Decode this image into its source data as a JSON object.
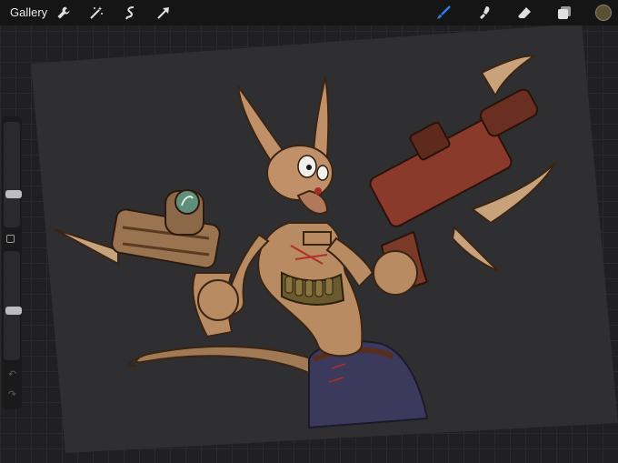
{
  "app": {
    "gallery_label": "Gallery"
  },
  "toolbar": {
    "left_tools": [
      "wrench-icon",
      "magic-wand-icon",
      "selection-icon",
      "transform-arrow-icon"
    ],
    "right_tools": [
      "brush-icon",
      "smudge-icon",
      "eraser-icon",
      "layers-icon"
    ],
    "active_tool": "brush-icon",
    "active_color": "#5a5135",
    "brush_accent": "#2f7de1"
  },
  "sidebar": {
    "brush_size_level": 0.3,
    "opacity_level": 0.45
  }
}
